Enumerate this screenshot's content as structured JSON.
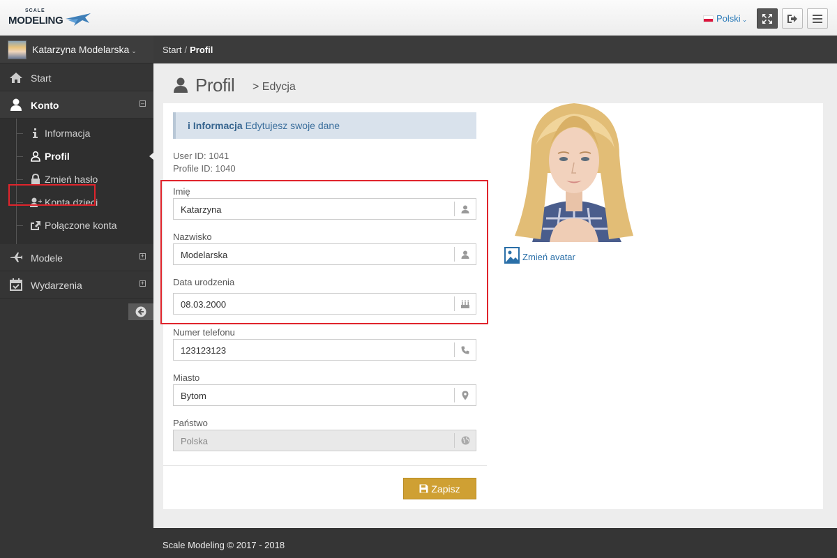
{
  "brand": {
    "logo_small": "SCALE",
    "logo_big": "MODELING"
  },
  "topbar": {
    "language": "Polski"
  },
  "sidebar": {
    "user_name": "Katarzyna Modelarska",
    "menu": {
      "start": "Start",
      "konto": "Konto",
      "modele": "Modele",
      "wydarzenia": "Wydarzenia"
    },
    "konto_items": [
      {
        "label": "Informacja",
        "icon": "info-icon"
      },
      {
        "label": "Profil",
        "icon": "user-outline-icon"
      },
      {
        "label": "Zmień hasło",
        "icon": "lock-icon"
      },
      {
        "label": "Konta dzieci",
        "icon": "user-plus-icon"
      },
      {
        "label": "Połączone konta",
        "icon": "share-icon"
      }
    ]
  },
  "breadcrumb": {
    "home": "Start",
    "separator": "/",
    "current": "Profil"
  },
  "page": {
    "title": "Profil",
    "subtitle": "> Edycja"
  },
  "info": {
    "heading": "Informacja",
    "text": "Edytujesz swoje dane"
  },
  "ids": {
    "user_id": "User ID: 1041",
    "profile_id": "Profile ID: 1040"
  },
  "form": {
    "first_name": {
      "label": "Imię",
      "value": "Katarzyna",
      "icon": "user-icon"
    },
    "last_name": {
      "label": "Nazwisko",
      "value": "Modelarska",
      "icon": "user-icon"
    },
    "birth_date": {
      "label": "Data urodzenia",
      "value": "08.03.2000",
      "icon": "birthday-cake-icon"
    },
    "phone": {
      "label": "Numer telefonu",
      "value": "123123123",
      "icon": "phone-icon"
    },
    "city": {
      "label": "Miasto",
      "value": "Bytom",
      "icon": "map-marker-icon"
    },
    "country": {
      "label": "Państwo",
      "value": "Polska",
      "icon": "globe-icon"
    },
    "save_label": "Zapisz"
  },
  "avatar": {
    "change_label": "Zmień avatar"
  },
  "footer": {
    "text": "Scale Modeling © 2017 - 2018"
  },
  "colors": {
    "accent": "#cfa033",
    "link": "#2a6fa8",
    "highlight": "#e0242c",
    "sidebar": "#353535"
  }
}
